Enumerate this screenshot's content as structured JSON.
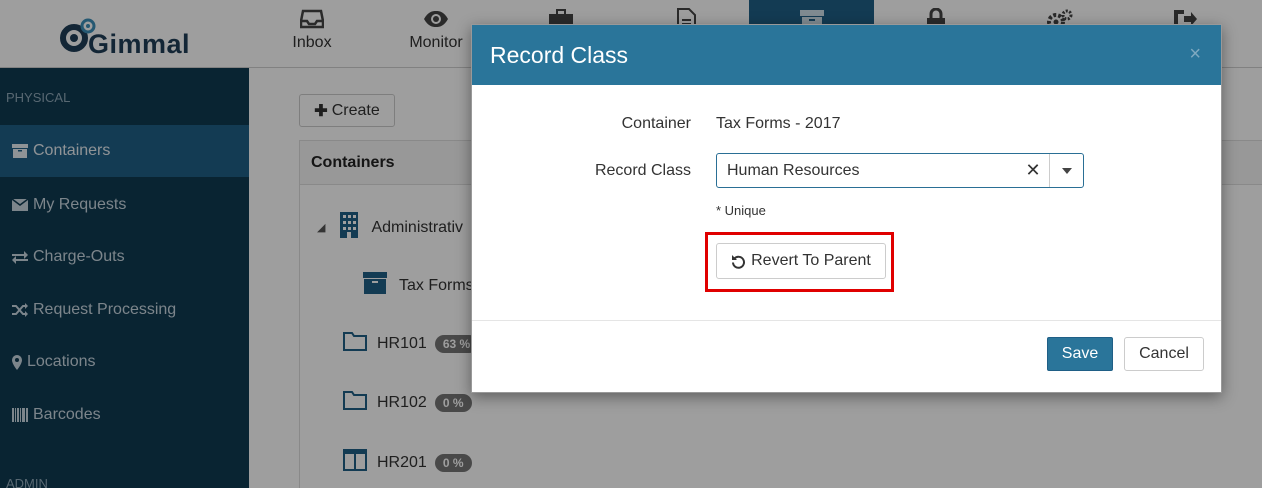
{
  "app": {
    "logo_text": "Gimmal"
  },
  "nav": {
    "items": [
      {
        "label": "Inbox",
        "icon": "inbox-icon"
      },
      {
        "label": "Monitor",
        "icon": "eye-icon"
      },
      {
        "label": "",
        "icon": "briefcase-icon"
      },
      {
        "label": "",
        "icon": "document-icon"
      },
      {
        "label": "",
        "icon": "archive-box-icon",
        "active": true
      },
      {
        "label": "",
        "icon": "lock-icon"
      },
      {
        "label": "",
        "icon": "gears-icon"
      },
      {
        "label": "",
        "icon": "sign-out-icon"
      }
    ]
  },
  "sidebar": {
    "section_physical": "PHYSICAL",
    "section_admin": "ADMIN",
    "items": [
      {
        "label": "Containers",
        "icon": "archive-box-icon",
        "active": true
      },
      {
        "label": "My Requests",
        "icon": "envelope-icon"
      },
      {
        "label": "Charge-Outs",
        "icon": "exchange-icon"
      },
      {
        "label": "Request Processing",
        "icon": "shuffle-icon"
      },
      {
        "label": "Locations",
        "icon": "map-marker-icon"
      },
      {
        "label": "Barcodes",
        "icon": "barcode-icon"
      }
    ]
  },
  "main": {
    "create_label": "Create",
    "panel_title": "Containers",
    "tree": [
      {
        "label": "Administrativ",
        "icon": "building-icon"
      },
      {
        "label": "Tax Forms",
        "icon": "archive-box-icon"
      },
      {
        "label": "HR101",
        "icon": "folder-icon",
        "badge": "63 %"
      },
      {
        "label": "HR102",
        "icon": "folder-icon",
        "badge": "0 %"
      },
      {
        "label": "HR201",
        "icon": "columns-icon",
        "badge": "0 %"
      }
    ]
  },
  "modal": {
    "title": "Record Class",
    "close_symbol": "×",
    "container_label": "Container",
    "container_value": "Tax Forms - 2017",
    "record_class_label": "Record Class",
    "record_class_value": "Human Resources",
    "clear_symbol": "✕",
    "hint": "* Unique",
    "revert_label": "Revert To Parent",
    "save_label": "Save",
    "cancel_label": "Cancel"
  },
  "colors": {
    "header_blue": "#2a759a",
    "sidebar_bg": "#0f3a52",
    "highlight_red": "#e00000"
  }
}
